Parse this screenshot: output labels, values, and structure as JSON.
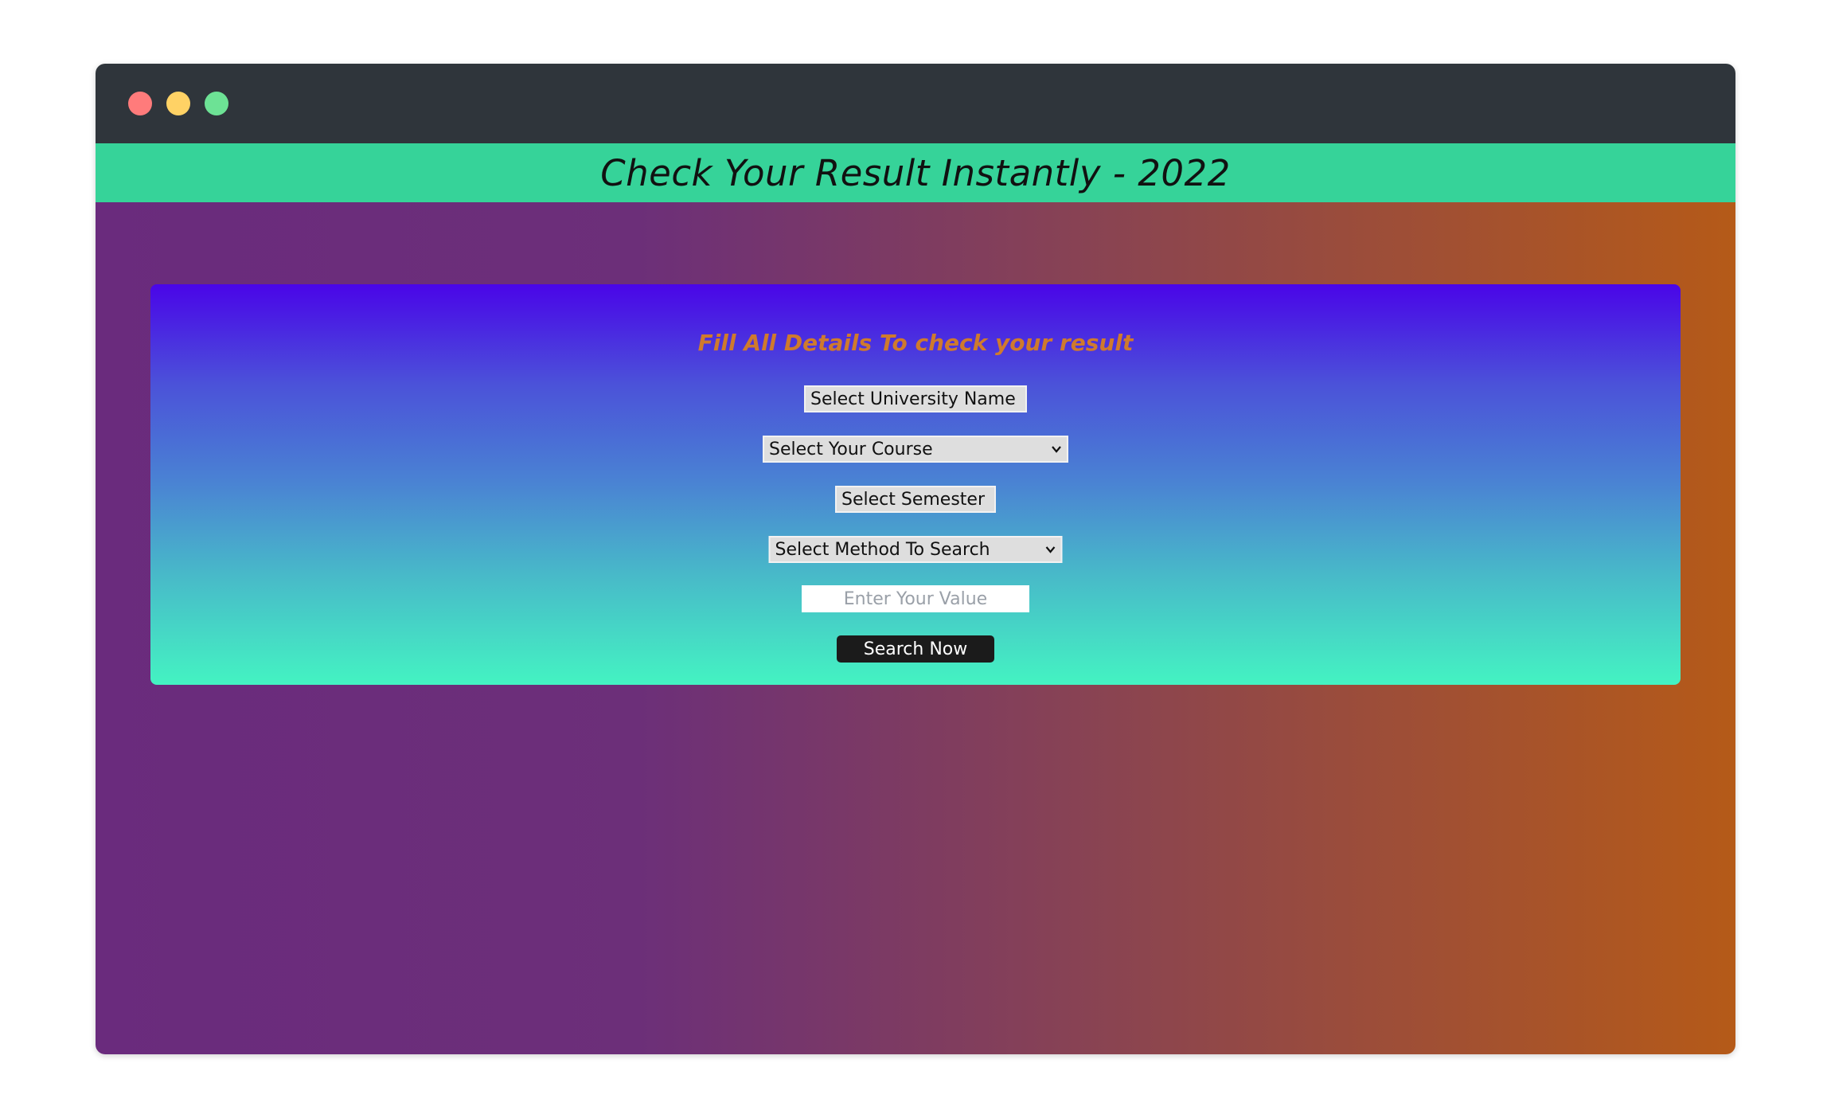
{
  "window": {
    "controls": [
      "close",
      "minimize",
      "maximize"
    ]
  },
  "header": {
    "title": "Check Your Result Instantly - 2022",
    "band_color": "#36d399"
  },
  "form": {
    "heading": "Fill All Details To check your result",
    "university_select": "Select University Name",
    "course_select": "Select Your Course",
    "semester_select": "Select Semester",
    "method_select": "Select Method To Search",
    "value_input": {
      "value": "",
      "placeholder": "Enter Your Value"
    },
    "search_button": "Search Now"
  },
  "colors": {
    "titlebar": "#2f353b",
    "heading_accent": "#cf7a2d",
    "button_bg": "#1b1b1b"
  }
}
